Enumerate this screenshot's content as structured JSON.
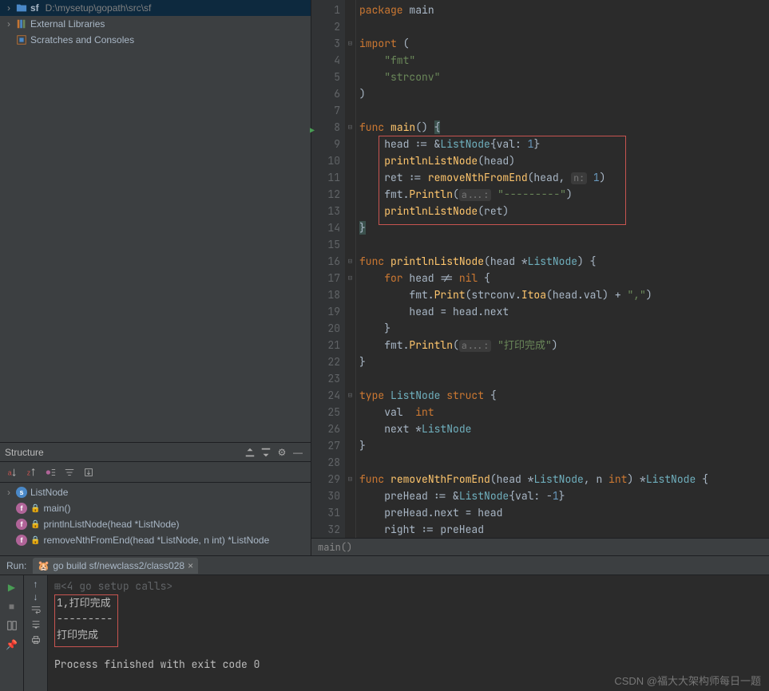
{
  "project": {
    "root_name": "sf",
    "root_path": "D:\\mysetup\\gopath\\src\\sf",
    "external_libs": "External Libraries",
    "scratches": "Scratches and Consoles"
  },
  "structure": {
    "title": "Structure",
    "items": [
      {
        "kind": "struct",
        "label": "ListNode",
        "locked": false,
        "expandable": true
      },
      {
        "kind": "func",
        "label": "main()",
        "locked": true
      },
      {
        "kind": "func",
        "label": "printlnListNode(head *ListNode)",
        "locked": true
      },
      {
        "kind": "func",
        "label": "removeNthFromEnd(head *ListNode, n int) *ListNode",
        "locked": true
      }
    ]
  },
  "editor": {
    "lines": [
      {
        "n": 1,
        "html": "<span class='kw'>package</span> <span class='ty'>main</span>"
      },
      {
        "n": 2,
        "html": ""
      },
      {
        "n": 3,
        "html": "<span class='kw'>import</span> ("
      },
      {
        "n": 4,
        "html": "    <span class='str'>\"fmt\"</span>"
      },
      {
        "n": 5,
        "html": "    <span class='str'>\"strconv\"</span>"
      },
      {
        "n": 6,
        "html": ")"
      },
      {
        "n": 7,
        "html": ""
      },
      {
        "n": 8,
        "html": "<span class='kw'>func</span> <span class='fn'>main</span>() <span class='brace-hl'>{</span>",
        "run": true
      },
      {
        "n": 9,
        "html": "    head := &amp;<span class='ty2'>ListNode</span>{val: <span class='num'>1</span>}"
      },
      {
        "n": 10,
        "html": "    <span class='fn'>printlnListNode</span>(head)"
      },
      {
        "n": 11,
        "html": "    ret := <span class='fn'>removeNthFromEnd</span>(head, <span class='hint'>n:</span> <span class='num'>1</span>)"
      },
      {
        "n": 12,
        "html": "    fmt.<span class='fn'>Println</span>(<span class='hint'>a...:</span> <span class='str'>\"---------\"</span>)"
      },
      {
        "n": 13,
        "html": "    <span class='fn'>printlnListNode</span>(ret)"
      },
      {
        "n": 14,
        "html": "<span class='brace-hl'>}</span>"
      },
      {
        "n": 15,
        "html": ""
      },
      {
        "n": 16,
        "html": "<span class='kw'>func</span> <span class='fn'>printlnListNode</span>(head *<span class='ty2'>ListNode</span>) {"
      },
      {
        "n": 17,
        "html": "    <span class='kw'>for</span> head != <span class='kw'>nil</span> {"
      },
      {
        "n": 18,
        "html": "        fmt.<span class='fn'>Print</span>(strconv.<span class='fn'>Itoa</span>(head.val) + <span class='str'>\",\"</span>)"
      },
      {
        "n": 19,
        "html": "        head = head.next"
      },
      {
        "n": 20,
        "html": "    }"
      },
      {
        "n": 21,
        "html": "    fmt.<span class='fn'>Println</span>(<span class='hint'>a...:</span> <span class='str'>\"打印完成\"</span>)"
      },
      {
        "n": 22,
        "html": "}"
      },
      {
        "n": 23,
        "html": ""
      },
      {
        "n": 24,
        "html": "<span class='kw'>type</span> <span class='ty2'>ListNode</span> <span class='kw'>struct</span> {"
      },
      {
        "n": 25,
        "html": "    val  <span class='kw'>int</span>"
      },
      {
        "n": 26,
        "html": "    next *<span class='ty2'>ListNode</span>"
      },
      {
        "n": 27,
        "html": "}"
      },
      {
        "n": 28,
        "html": ""
      },
      {
        "n": 29,
        "html": "<span class='kw'>func</span> <span class='fn'>removeNthFromEnd</span>(head *<span class='ty2'>ListNode</span>, n <span class='kw'>int</span>) *<span class='ty2'>ListNode</span> {"
      },
      {
        "n": 30,
        "html": "    preHead := &amp;<span class='ty2'>ListNode</span>{val: -<span class='num'>1</span>}"
      },
      {
        "n": 31,
        "html": "    preHead.next = head"
      },
      {
        "n": 32,
        "html": "    right := preHead"
      }
    ],
    "breadcrumb": "main()"
  },
  "run": {
    "label": "Run:",
    "tab_title": "go build sf/newclass2/class028",
    "console": {
      "setup": "<4 go setup calls>",
      "l1": "1,打印完成",
      "l2": "---------",
      "l3": "打印完成",
      "exit": "Process finished with exit code 0"
    }
  },
  "watermark": "CSDN @福大大架构师每日一题"
}
